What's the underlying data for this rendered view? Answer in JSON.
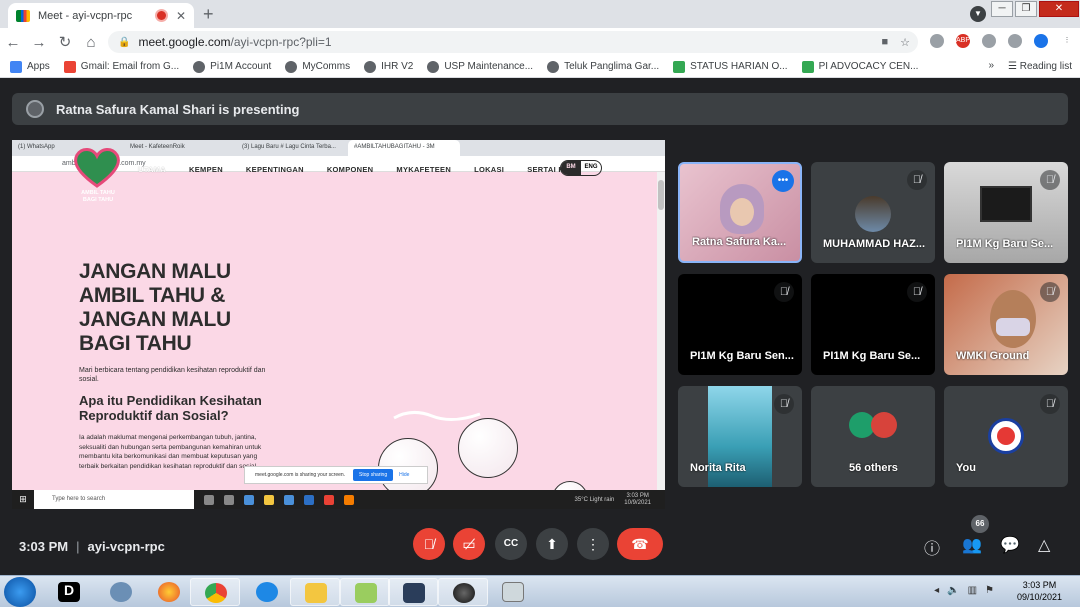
{
  "browser": {
    "tab_title": "Meet - ayi-vcpn-rpc",
    "url_host": "meet.google.com",
    "url_path": "/ayi-vcpn-rpc?pli=1",
    "bookmarks": [
      {
        "label": "Apps",
        "color": "#4285f4"
      },
      {
        "label": "Gmail: Email from G...",
        "color": "#ea4335"
      },
      {
        "label": "Pi1M Account",
        "color": "#5f6368"
      },
      {
        "label": "MyComms",
        "color": "#5f6368"
      },
      {
        "label": "IHR V2",
        "color": "#5f6368"
      },
      {
        "label": "USP Maintenance...",
        "color": "#5f6368"
      },
      {
        "label": "Teluk Panglima Gar...",
        "color": "#5f6368"
      },
      {
        "label": "STATUS HARIAN O...",
        "color": "#34a853"
      },
      {
        "label": "PI ADVOCACY CEN...",
        "color": "#34a853"
      }
    ],
    "reading_list": "Reading list",
    "more_bookmarks": "»"
  },
  "meet": {
    "presenting_banner": "Ratna Safura Kamal Shari is presenting",
    "time": "3:03 PM",
    "meeting_code": "ayi-vcpn-rpc",
    "people_count": "66",
    "participants": [
      {
        "name": "Ratna Safura Ka...",
        "speaking": true
      },
      {
        "name": "MUHAMMAD HAZ..."
      },
      {
        "name": "PI1M Kg Baru Se..."
      },
      {
        "name": "PI1M Kg Baru Sen..."
      },
      {
        "name": "PI1M Kg Baru Se..."
      },
      {
        "name": "WMKI Ground"
      },
      {
        "name": "Norita Rita"
      },
      {
        "name": "56 others"
      },
      {
        "name": "You"
      }
    ]
  },
  "shared_screen": {
    "tabs": [
      "(1) WhatsApp",
      "Meet - KafeteenRoik",
      "(3) Lagu Baru # Lagu Cinta Terba...",
      "#AMBILTAHUBAGITAHU - 3M"
    ],
    "url": "ambiltahubagitahu.com.my",
    "logo_text": "AMBIL TAHU BAGI TAHU",
    "menu": [
      "UTAMA",
      "KEMPEN",
      "KEPENTINGAN",
      "KOMPONEN",
      "MYKAFETEEN",
      "LOKASI",
      "SERTAI KAMI"
    ],
    "lang_bm": "BM",
    "lang_eng": "ENG",
    "hero": "JANGAN MALU AMBIL TAHU & JANGAN MALU BAGI TAHU",
    "subtitle": "Mari berbicara tentang pendidikan kesihatan reproduktif dan sosial.",
    "question": "Apa itu Pendidikan Kesihatan Reproduktif dan Sosial?",
    "body": "Ia adalah maklumat mengenai perkembangan tubuh, jantina, seksualiti dan hubungan serta pembangunan kemahiran untuk membantu kita berkomunikasi dan membuat keputusan yang terbaik berkaitan pendidikan kesihatan reproduktif dan sosial.",
    "share_notice": "meet.google.com is sharing your screen.",
    "stop_sharing": "Stop sharing",
    "hide": "Hide",
    "task_search": "Type here to search",
    "weather": "35°C  Light rain",
    "clock_time": "3:03 PM",
    "clock_date": "10/9/2021"
  },
  "taskbar": {
    "time": "3:03 PM",
    "date": "09/10/2021"
  }
}
